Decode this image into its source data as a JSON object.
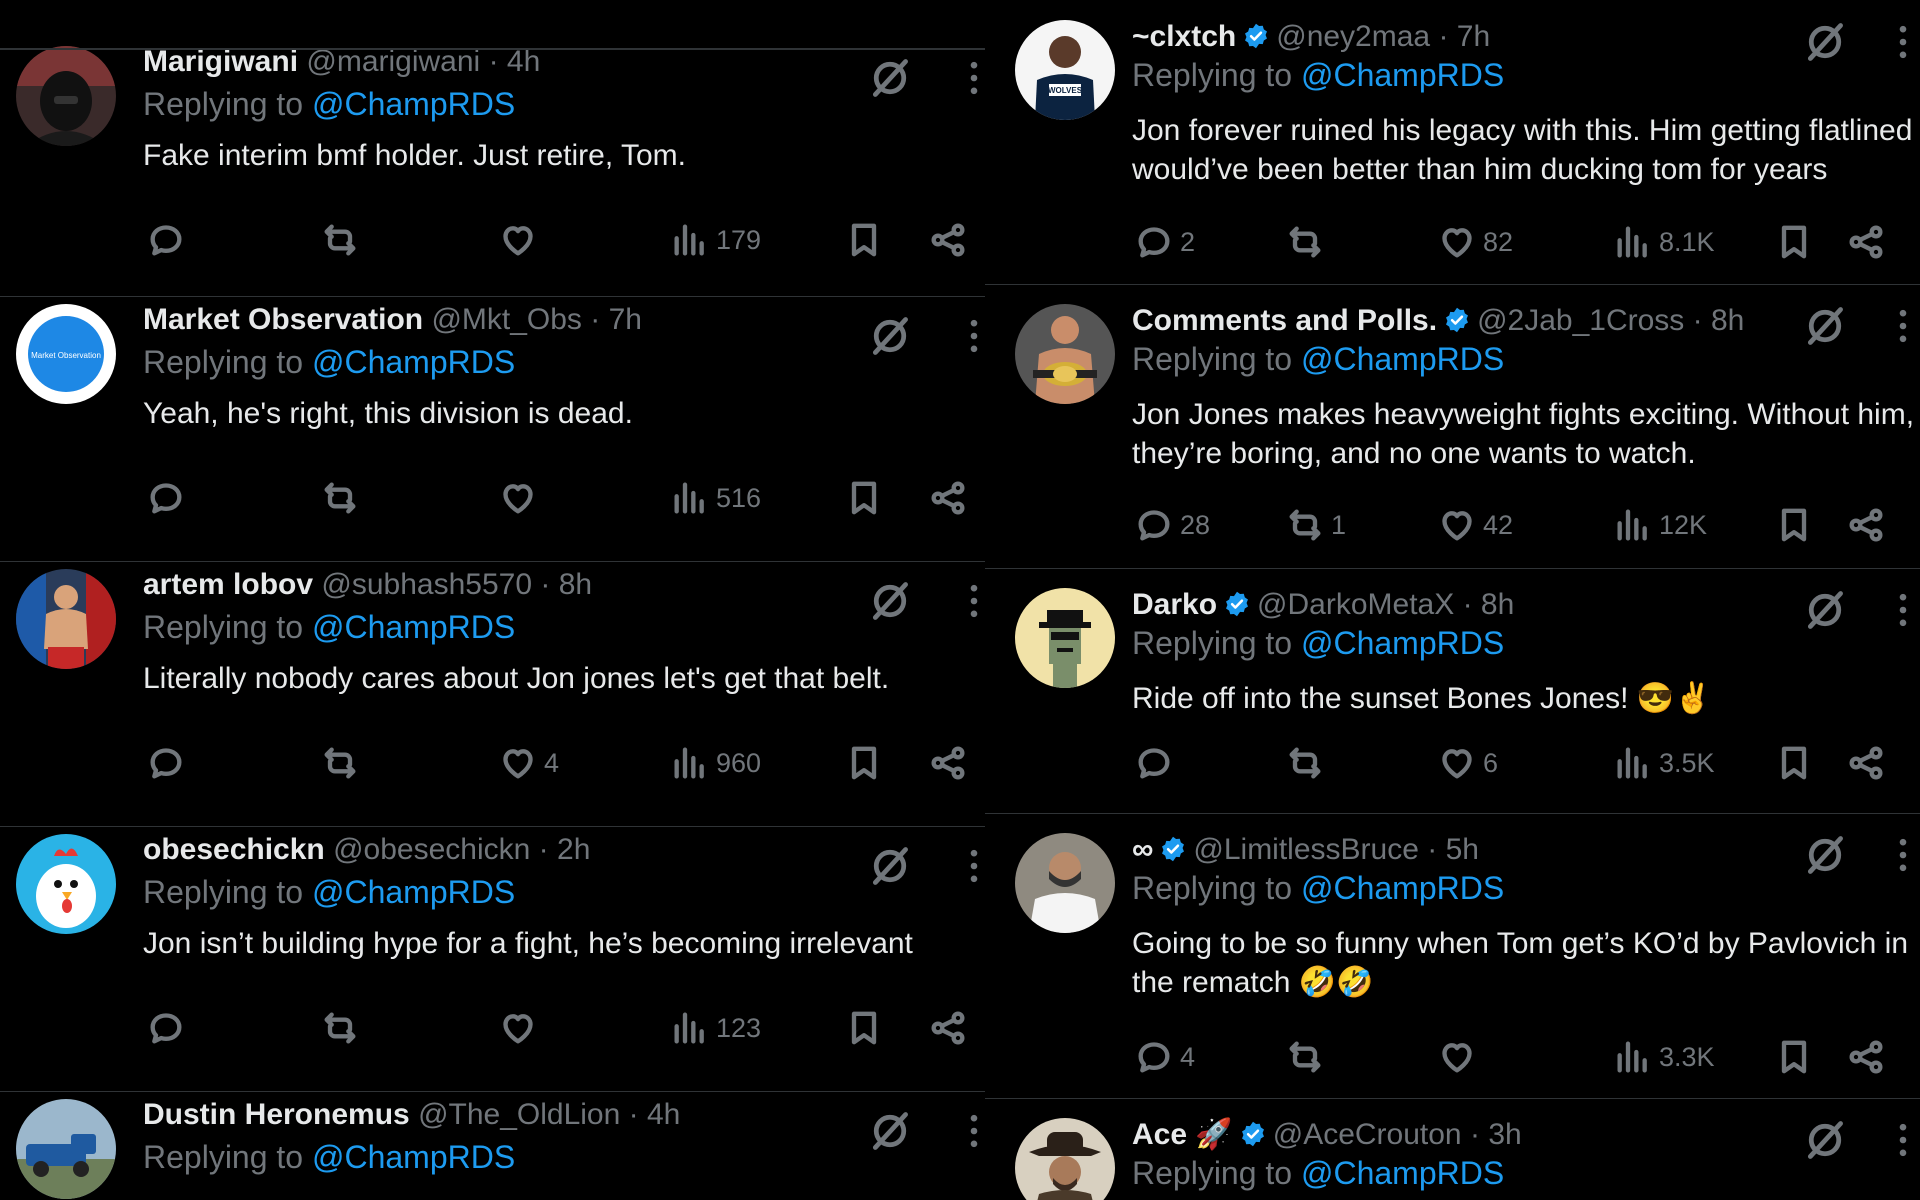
{
  "left_tweets": [
    {
      "name": "Marigiwani",
      "verified": false,
      "handle": "@marigiwani",
      "time": "4h",
      "replying_prefix": "Replying to",
      "replying_to": "@ChampRDS",
      "text": "Fake interim bmf holder. Just retire, Tom.",
      "stats": {
        "replies": "",
        "reposts": "",
        "likes": "",
        "views": "179"
      },
      "avatar": "dark-hooded-figure-avatar"
    },
    {
      "name": "Market Observation",
      "verified": false,
      "handle": "@Mkt_Obs",
      "time": "7h",
      "replying_prefix": "Replying to",
      "replying_to": "@ChampRDS",
      "text": "Yeah, he's right, this division is dead.",
      "stats": {
        "replies": "",
        "reposts": "",
        "likes": "",
        "views": "516"
      },
      "avatar": "market-observation-logo",
      "avatar_text": "Market Observation"
    },
    {
      "name": "artem lobov",
      "verified": false,
      "handle": "@subhash5570",
      "time": "8h",
      "replying_prefix": "Replying to",
      "replying_to": "@ChampRDS",
      "text": "Literally nobody cares about Jon jones let's get that belt.",
      "stats": {
        "replies": "",
        "reposts": "",
        "likes": "4",
        "views": "960"
      },
      "avatar": "fighter-photo-avatar"
    },
    {
      "name": "obesechickn",
      "verified": false,
      "handle": "@obesechickn",
      "time": "2h",
      "replying_prefix": "Replying to",
      "replying_to": "@ChampRDS",
      "text": "Jon isn’t building hype for a fight, he’s becoming irrelevant",
      "stats": {
        "replies": "",
        "reposts": "",
        "likes": "",
        "views": "123"
      },
      "avatar": "cartoon-chicken-avatar"
    },
    {
      "name": "Dustin Heronemus",
      "verified": false,
      "handle": "@The_OldLion",
      "time": "4h",
      "replying_prefix": "Replying to",
      "replying_to": "@ChampRDS",
      "text": "",
      "stats": {
        "replies": "",
        "reposts": "",
        "likes": "",
        "views": ""
      },
      "avatar": "blue-truck-avatar"
    }
  ],
  "right_tweets": [
    {
      "name": "~clxtch",
      "verified": true,
      "handle": "@ney2maa",
      "time": "7h",
      "replying_prefix": "Replying to",
      "replying_to": "@ChampRDS",
      "text_lines": [
        "Jon forever ruined his legacy with this. Him getting flatlined",
        "would’ve been better than him ducking tom for years"
      ],
      "stats": {
        "replies": "2",
        "reposts": "",
        "likes": "82",
        "views": "8.1K"
      },
      "avatar": "basketball-player-avatar",
      "avatar_text": "WOLVES"
    },
    {
      "name": "Comments and Polls.",
      "verified": true,
      "handle": "@2Jab_1Cross",
      "time": "8h",
      "replying_prefix": "Replying to",
      "replying_to": "@ChampRDS",
      "text_lines": [
        "Jon Jones makes heavyweight fights exciting. Without him,",
        "they’re boring, and no one wants to watch."
      ],
      "stats": {
        "replies": "28",
        "reposts": "1",
        "likes": "42",
        "views": "12K"
      },
      "avatar": "champion-belt-avatar"
    },
    {
      "name": "Darko",
      "verified": true,
      "handle": "@DarkoMetaX",
      "time": "8h",
      "replying_prefix": "Replying to",
      "replying_to": "@ChampRDS",
      "text_lines": [
        "Ride off into the sunset Bones Jones! 😎✌️"
      ],
      "stats": {
        "replies": "",
        "reposts": "",
        "likes": "6",
        "views": "3.5K"
      },
      "avatar": "pixel-punk-avatar"
    },
    {
      "name": "∞",
      "verified": true,
      "handle": "@LimitlessBruce",
      "time": "5h",
      "replying_prefix": "Replying to",
      "replying_to": "@ChampRDS",
      "text_lines": [
        "Going to be so funny when Tom get’s KO’d by Pavlovich in",
        "the rematch 🤣🤣"
      ],
      "stats": {
        "replies": "4",
        "reposts": "",
        "likes": "",
        "views": "3.3K"
      },
      "avatar": "man-photo-avatar"
    },
    {
      "name": "Ace 🚀",
      "verified": true,
      "handle": "@AceCrouton",
      "time": "3h",
      "replying_prefix": "Replying to",
      "replying_to": "@ChampRDS",
      "text_lines": [],
      "stats": {
        "replies": "",
        "reposts": "",
        "likes": "",
        "views": ""
      },
      "avatar": "cowboy-avatar"
    }
  ],
  "separator": "·",
  "icons": {
    "reply": "reply-icon",
    "repost": "repost-icon",
    "like": "like-icon",
    "views": "views-icon",
    "bookmark": "bookmark-icon",
    "share": "share-icon",
    "grok": "grok-icon",
    "more": "more-icon",
    "verified": "verified-badge-icon"
  },
  "colors": {
    "background": "#000000",
    "accent": "#1d9bf0",
    "muted": "#71767b",
    "text": "#e7e9ea"
  }
}
